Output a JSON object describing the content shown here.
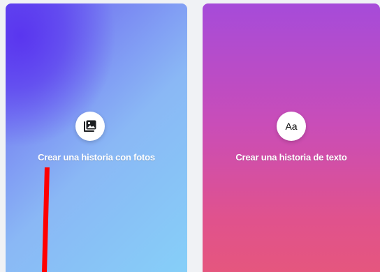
{
  "cards": {
    "photo": {
      "label": "Crear una historia con fotos",
      "icon": "photo-story-icon"
    },
    "text": {
      "label": "Crear una historia de texto",
      "icon": "text-story-icon",
      "icon_text": "Aa"
    }
  },
  "colors": {
    "page_background": "#f0f2f5",
    "photo_card_gradient": [
      "#5a36ef",
      "#8ab8f5",
      "#86cff8"
    ],
    "text_card_gradient": [
      "#a64bd9",
      "#c94db8",
      "#e5567e"
    ],
    "annotation": "#ff0000"
  }
}
